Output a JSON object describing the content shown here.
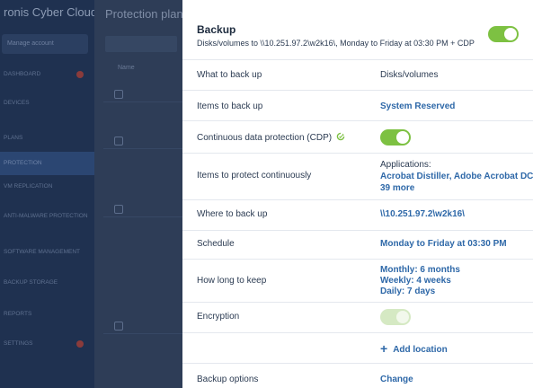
{
  "background": {
    "brand": "ronis Cyber Cloud",
    "manage_label": "Manage account",
    "main_title": "Protection plans",
    "column_header": "Name",
    "nav_items": [
      {
        "label": "DASHBOARD",
        "badge": true
      },
      {
        "label": "DEVICES",
        "badge": false
      },
      {
        "label": "PLANS",
        "badge": false
      },
      {
        "label": "Protection",
        "badge": false,
        "active": true
      },
      {
        "label": "VM replication",
        "badge": false
      },
      {
        "label": "ANTI-MALWARE PROTECTION",
        "badge": false
      },
      {
        "label": "SOFTWARE MANAGEMENT",
        "badge": false
      },
      {
        "label": "BACKUP STORAGE",
        "badge": false
      },
      {
        "label": "REPORTS",
        "badge": false
      },
      {
        "label": "SETTINGS",
        "badge": true
      }
    ]
  },
  "panel": {
    "title": "Backup",
    "subtitle": "Disks/volumes to \\\\10.251.97.2\\w2k16\\, Monday to Friday at 03:30 PM + CDP",
    "enabled": true,
    "rows": {
      "what": {
        "label": "What to back up",
        "value": "Disks/volumes"
      },
      "items": {
        "label": "Items to back up",
        "value": "System Reserved"
      },
      "cdp": {
        "label": "Continuous data protection (CDP)",
        "enabled": true
      },
      "protect": {
        "label": "Items to protect continuously",
        "heading": "Applications:",
        "apps": "Acrobat Distiller, Adobe Acrobat DC",
        "more": "39 more"
      },
      "where": {
        "label": "Where to back up",
        "value": "\\\\10.251.97.2\\w2k16\\"
      },
      "schedule": {
        "label": "Schedule",
        "value": "Monday to Friday at 03:30 PM"
      },
      "keep": {
        "label": "How long to keep",
        "monthly": "Monthly: 6 months",
        "weekly": "Weekly: 4 weeks",
        "daily": "Daily: 7 days"
      },
      "encryption": {
        "label": "Encryption",
        "enabled": false
      },
      "add_location": {
        "label": "Add location"
      },
      "options": {
        "label": "Backup options",
        "value": "Change"
      }
    }
  },
  "colors": {
    "toggle_on": "#7dc142",
    "link": "#2e68a8",
    "overlay": "#1f3150"
  },
  "icons": {
    "cdp": "cdp-refresh-icon",
    "add": "plus-icon"
  }
}
